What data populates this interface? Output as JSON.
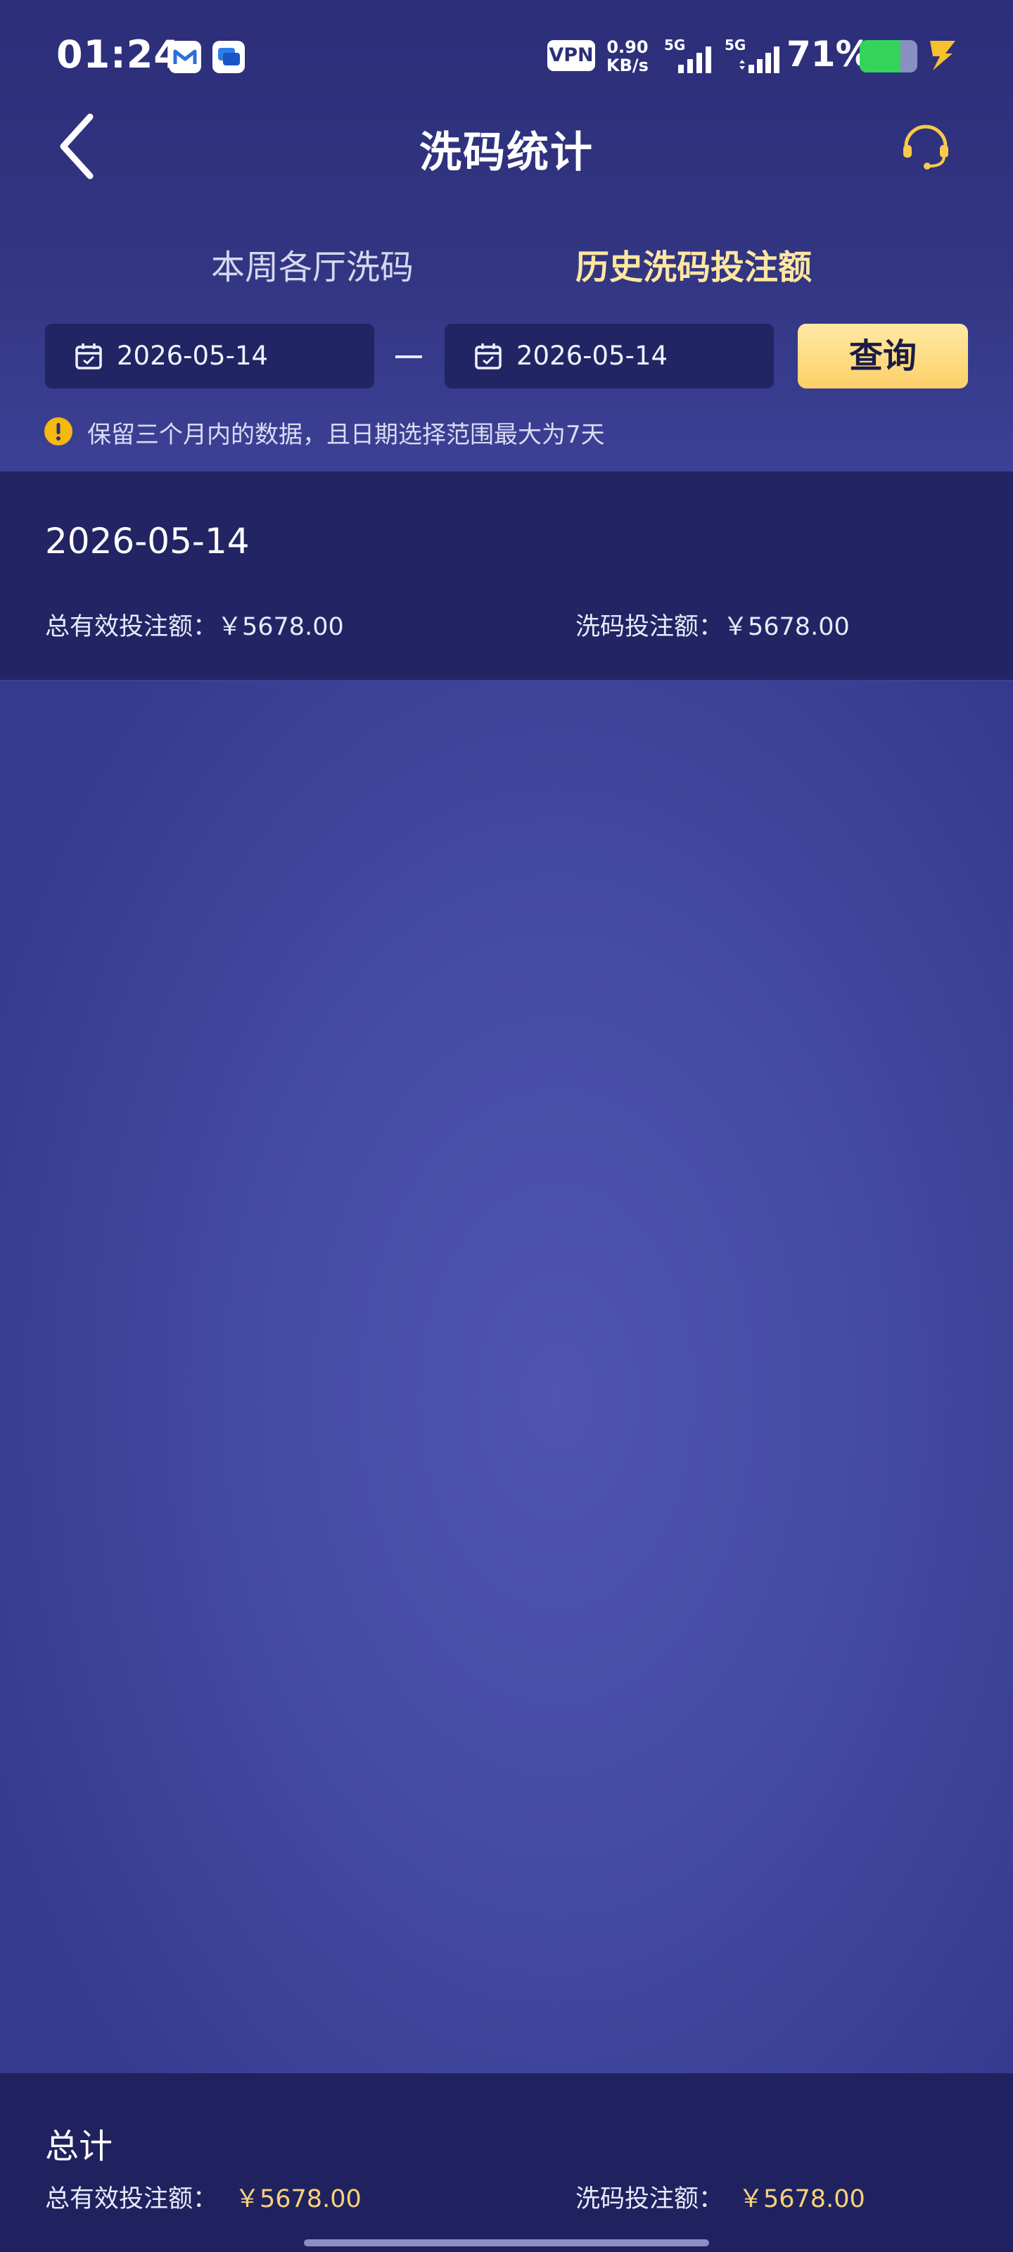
{
  "status_bar": {
    "time": "01:24",
    "vpn": "VPN",
    "speed_value": "0.90",
    "speed_unit": "KB/s",
    "net1": "5G",
    "net2": "5G",
    "battery": "71%",
    "battery_level": 0.71,
    "icons": [
      "gmail-icon",
      "message-icon",
      "signal-icon",
      "battery-icon",
      "charging-bolt-icon"
    ]
  },
  "nav": {
    "title": "洗码统计",
    "icons": [
      "back-chevron-icon",
      "customer-support-headset-icon"
    ]
  },
  "tabs": [
    {
      "label": "本周各厅洗码",
      "active": false
    },
    {
      "label": "历史洗码投注额",
      "active": true
    }
  ],
  "filters": {
    "start_date": "2026-05-14",
    "end_date": "2026-05-14",
    "separator": "—",
    "query_label": "查询",
    "notice": "保留三个月内的数据，且日期选择范围最大为7天",
    "icons": [
      "calendar-icon",
      "warning-icon"
    ]
  },
  "records": [
    {
      "date": "2026-05-14",
      "total_valid_bet": "总有效投注额：￥5678.00",
      "rebate_bet": "洗码投注额：￥5678.00"
    }
  ],
  "total": {
    "label": "总计",
    "total_valid_bet_label": "总有效投注额：",
    "total_valid_bet_value": "￥5678.00",
    "rebate_bet_label": "洗码投注额：",
    "rebate_bet_value": "￥5678.00"
  },
  "colors": {
    "active_tab": "#ffe7a0",
    "button_gold": "#fdd068",
    "amount_gold": "#f8d27a",
    "warning": "#f5b80f",
    "battery_green": "#34d45a",
    "panel": "#222464"
  }
}
